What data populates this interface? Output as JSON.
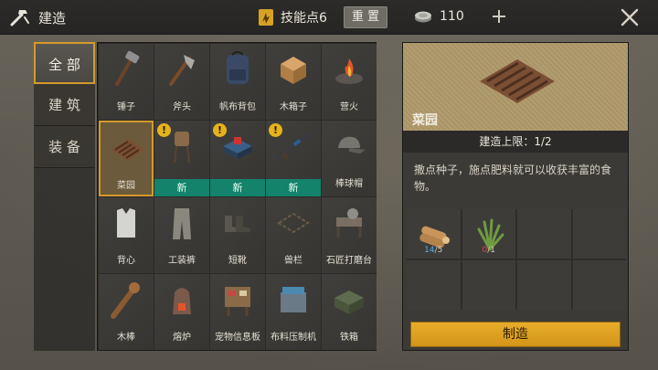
{
  "header": {
    "title": "建造",
    "build_icon": "crossed-hammer-icon",
    "skill_points_label": "技能点6",
    "skill_icon": "skill-points-icon",
    "reset_label": "重 置",
    "coin_icon": "coin-icon",
    "coin_count": "110",
    "plus_icon": "plus-icon",
    "close_icon": "close-icon"
  },
  "tabs": [
    {
      "label": "全 部",
      "active": true
    },
    {
      "label": "建 筑",
      "active": false
    },
    {
      "label": "装 备",
      "active": false
    }
  ],
  "items": [
    {
      "label": "锤子",
      "icon": "hammer-icon",
      "warning": false,
      "new": false,
      "selected": false
    },
    {
      "label": "斧头",
      "icon": "axe-icon",
      "warning": false,
      "new": false,
      "selected": false
    },
    {
      "label": "帆布背包",
      "icon": "backpack-icon",
      "warning": false,
      "new": false,
      "selected": false
    },
    {
      "label": "木箱子",
      "icon": "wooden-crate-icon",
      "warning": false,
      "new": false,
      "selected": false
    },
    {
      "label": "营火",
      "icon": "campfire-icon",
      "warning": false,
      "new": false,
      "selected": false
    },
    {
      "label": "菜园",
      "icon": "garden-plot-icon",
      "warning": false,
      "new": false,
      "selected": true
    },
    {
      "label": "新",
      "icon": "water-tank-icon",
      "warning": true,
      "new": true,
      "selected": false
    },
    {
      "label": "新",
      "icon": "workbench-icon",
      "warning": true,
      "new": true,
      "selected": false
    },
    {
      "label": "新",
      "icon": "rifle-icon",
      "warning": true,
      "new": true,
      "selected": false
    },
    {
      "label": "棒球帽",
      "icon": "baseball-cap-icon",
      "warning": false,
      "new": false,
      "selected": false
    },
    {
      "label": "背心",
      "icon": "vest-icon",
      "warning": false,
      "new": false,
      "selected": false
    },
    {
      "label": "工装裤",
      "icon": "cargo-pants-icon",
      "warning": false,
      "new": false,
      "selected": false
    },
    {
      "label": "短靴",
      "icon": "boots-icon",
      "warning": false,
      "new": false,
      "selected": false
    },
    {
      "label": "兽栏",
      "icon": "animal-pen-icon",
      "warning": false,
      "new": false,
      "selected": false
    },
    {
      "label": "石匠打磨台",
      "icon": "stonemason-table-icon",
      "warning": false,
      "new": false,
      "selected": false
    },
    {
      "label": "木棒",
      "icon": "wooden-club-icon",
      "warning": false,
      "new": false,
      "selected": false
    },
    {
      "label": "熔炉",
      "icon": "furnace-icon",
      "warning": false,
      "new": false,
      "selected": false
    },
    {
      "label": "宠物信息板",
      "icon": "pet-board-icon",
      "warning": false,
      "new": false,
      "selected": false
    },
    {
      "label": "布料压制机",
      "icon": "cloth-press-icon",
      "warning": false,
      "new": false,
      "selected": false
    },
    {
      "label": "铁箱",
      "icon": "iron-box-icon",
      "warning": false,
      "new": false,
      "selected": false
    }
  ],
  "detail": {
    "name": "菜园",
    "preview_icon": "garden-plot-icon",
    "limit": "建造上限：1/2",
    "description": "撒点种子，施点肥料就可以收获丰富的食物。",
    "materials": [
      {
        "icon": "wood-logs-icon",
        "have": "14",
        "need": "5",
        "sufficient": true
      },
      {
        "icon": "grass-plant-icon",
        "have": "0",
        "need": "1",
        "sufficient": false
      }
    ],
    "build_label": "制造"
  },
  "colors": {
    "accent_orange": "#d49a2c",
    "new_band_green": "#13836b",
    "build_button": "#e7ad2a",
    "warning_yellow": "#e6b31b",
    "qty_ok_blue": "#5aa8e6",
    "qty_bad_red": "#e04848"
  }
}
